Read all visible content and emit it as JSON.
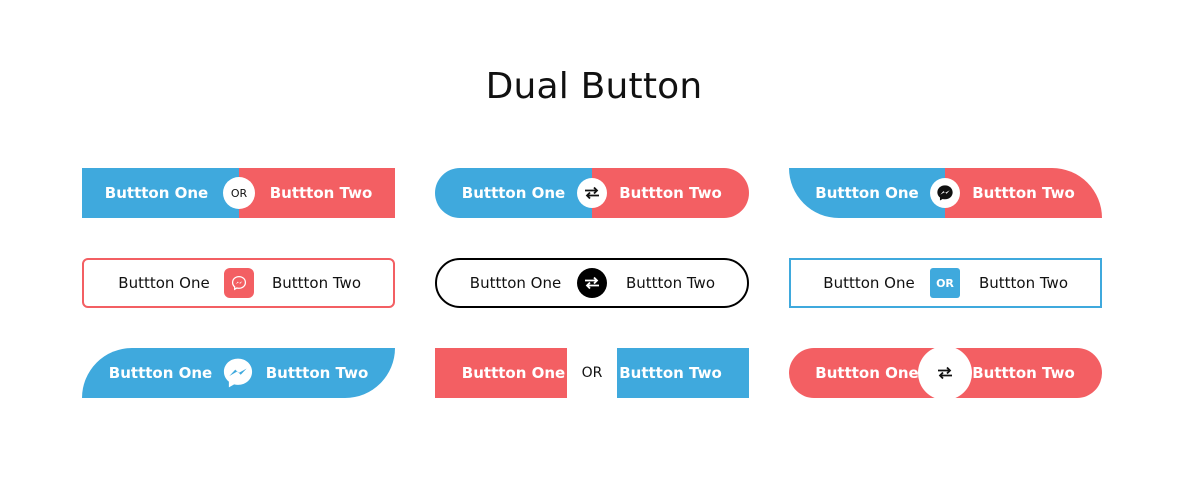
{
  "page": {
    "title": "Dual Button"
  },
  "buttons": {
    "one": "Buttton One",
    "two": "Buttton Two",
    "or": "OR"
  },
  "colors": {
    "blue": "#3fa9dd",
    "red": "#f35f63",
    "black": "#000000"
  },
  "icons": {
    "swap": "swap-arrows-icon",
    "messenger": "messenger-icon"
  }
}
